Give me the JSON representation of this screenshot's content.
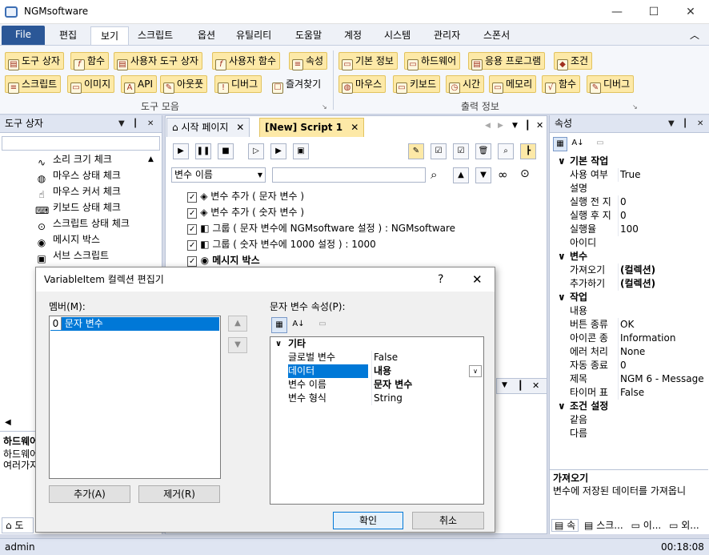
{
  "app": {
    "title": "NGMsoftware"
  },
  "window_controls": {
    "minimize": "—",
    "maximize": "☐",
    "close": "✕"
  },
  "menu": {
    "file": "File",
    "items": [
      "편집",
      "보기",
      "스크립트",
      "옵션",
      "유틸리티",
      "도움말",
      "계정",
      "시스템",
      "관리자",
      "스폰서"
    ],
    "collapse": "︿"
  },
  "ribbon": {
    "left_row1": [
      "도구 상자",
      "함수",
      "사용자 도구 상자",
      "사용자 함수",
      "속성"
    ],
    "left_row2": [
      "스크립트",
      "이미지",
      "API",
      "아웃풋",
      "디버그",
      "즐겨찾기"
    ],
    "left_group": "도구 모음",
    "right_row1": [
      "기본 정보",
      "하드웨어",
      "응용 프로그램",
      "조건"
    ],
    "right_row2": [
      "마우스",
      "키보드",
      "시간",
      "메모리",
      "함수",
      "디버그"
    ],
    "right_group": "출력 정보"
  },
  "toolbox": {
    "title": "도구 상자",
    "items": [
      "소리 크기 체크",
      "마우스 상태 체크",
      "마우스 커서 체크",
      "키보드 상태 체크",
      "스크립트 상태 체크",
      "메시지 박스",
      "서브 스크립트"
    ],
    "desc_title": "하드웨어",
    "desc_line1": "하드웨어",
    "desc_line2": "여러가지",
    "bottom_tab": "도"
  },
  "editor": {
    "tabs": [
      "시작 페이지",
      "[New] Script 1"
    ],
    "filter_select": "변수 이름",
    "filter_text": "",
    "lines": [
      "변수 추가 ( 문자 변수 )",
      "변수 추가 ( 숫자 변수 )",
      "그룹 ( 문자 변수에 NGMsoftware 설정 ) : NGMsoftware",
      "그룹 ( 숫자 변수에 1000 설정 ) : 1000",
      "메시지 박스"
    ]
  },
  "properties": {
    "title": "속성",
    "categories": [
      {
        "name": "기본 작업",
        "rows": [
          [
            "사용 여부",
            "True"
          ],
          [
            "설명",
            ""
          ],
          [
            "실행 전 지",
            "0"
          ],
          [
            "실행 후 지",
            "0"
          ],
          [
            "실행율",
            "100"
          ],
          [
            "아이디",
            ""
          ]
        ]
      },
      {
        "name": "변수",
        "rows": [
          [
            "가져오기",
            "(컬렉션)"
          ],
          [
            "추가하기",
            "(컬렉션)"
          ]
        ]
      },
      {
        "name": "작업",
        "rows": [
          [
            "내용",
            ""
          ],
          [
            "버튼 종류",
            "OK"
          ],
          [
            "아이콘 종",
            "Information"
          ],
          [
            "에러 처리",
            "None"
          ],
          [
            "자동 종료",
            "0"
          ],
          [
            "제목",
            "NGM 6 - Message"
          ],
          [
            "타이머 표",
            "False"
          ]
        ]
      },
      {
        "name": "조건 설정",
        "rows": [
          [
            "같음",
            ""
          ],
          [
            "다름",
            ""
          ]
        ]
      }
    ],
    "desc_title": "가져오기",
    "desc_text": "변수에 저장된 데이터를 가져옵니",
    "bottom_tabs": [
      "속",
      "스크...",
      "이...",
      "외..."
    ]
  },
  "status": {
    "user": "admin",
    "time": "00:18:08"
  },
  "dialog": {
    "title": "VariableItem 컬렉션 편집기",
    "help": "?",
    "close": "✕",
    "members_label": "멤버(M):",
    "member_index": "0",
    "member_name": "문자 변수",
    "props_label": "문자 변수 속성(P):",
    "category": "기타",
    "rows": [
      [
        "글로벌 변수",
        "False"
      ],
      [
        "데이터",
        "내용"
      ],
      [
        "변수 이름",
        "문자 변수"
      ],
      [
        "변수 형식",
        "String"
      ]
    ],
    "add": "추가(A)",
    "remove": "제거(R)",
    "ok": "확인",
    "cancel": "취소"
  }
}
